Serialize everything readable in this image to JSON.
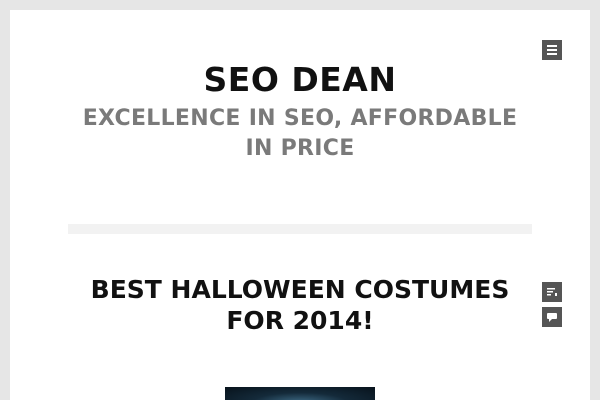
{
  "site": {
    "title": "SEO DEAN",
    "description": "EXCELLENCE IN SEO, AFFORDABLE IN PRICE"
  },
  "post": {
    "title": "BEST HALLOWEEN COSTUMES FOR 2014!"
  },
  "icons": {
    "menu": "menu-icon",
    "post_format": "standard-post-icon",
    "comments": "comment-icon"
  },
  "colors": {
    "background": "#e6e6e6",
    "page": "#ffffff",
    "title": "#111111",
    "description": "#7a7a7a",
    "icon_bg": "#555555",
    "divider": "#f2f2f2"
  }
}
